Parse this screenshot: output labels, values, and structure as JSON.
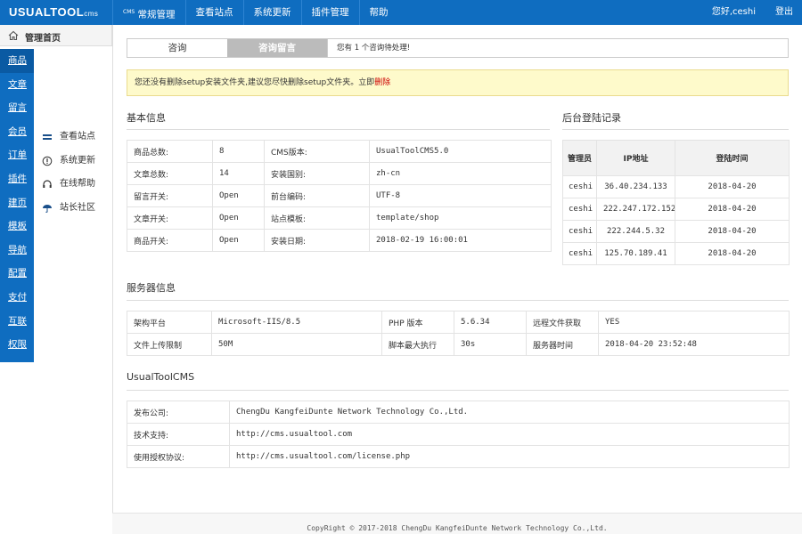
{
  "app": {
    "logo_main": "USUALTOOL",
    "logo_sub": "cms"
  },
  "topnav": [
    {
      "prefix": "CMS",
      "label": "常规管理"
    },
    {
      "prefix": "",
      "label": "查看站点"
    },
    {
      "prefix": "",
      "label": "系统更新"
    },
    {
      "prefix": "",
      "label": "插件管理"
    },
    {
      "prefix": "",
      "label": "帮助"
    }
  ],
  "user": {
    "greeting": "您好,ceshi",
    "logout": "登出"
  },
  "home": {
    "label": "管理首页",
    "icon": "home-icon"
  },
  "sidebar": [
    "商品",
    "文章",
    "留言",
    "会员",
    "订单",
    "插件",
    "建页",
    "模板",
    "导航",
    "配置",
    "支付",
    "互联",
    "权限"
  ],
  "submenu": [
    {
      "label": "查看站点",
      "icon": "monitor-icon"
    },
    {
      "label": "系统更新",
      "icon": "info-circle-icon"
    },
    {
      "label": "在线帮助",
      "icon": "headphones-icon"
    },
    {
      "label": "站长社区",
      "icon": "umbrella-icon"
    }
  ],
  "tabs": {
    "tab1": "咨询",
    "tab2": "咨询留言",
    "message": "您有 1 个咨询待处理!"
  },
  "warning": {
    "text": "您还没有删除setup安装文件夹,建议您尽快删除setup文件夹。立即",
    "link": "删除"
  },
  "basic": {
    "title": "基本信息",
    "rows": [
      [
        "商品总数:",
        "8",
        "CMS版本:",
        "UsualToolCMS5.0"
      ],
      [
        "文章总数:",
        "14",
        "安装国别:",
        "zh-cn"
      ],
      [
        "留言开关:",
        "Open",
        "前台编码:",
        "UTF-8"
      ],
      [
        "文章开关:",
        "Open",
        "站点模板:",
        "template/shop"
      ],
      [
        "商品开关:",
        "Open",
        "安装日期:",
        "2018-02-19 16:00:01"
      ]
    ]
  },
  "login": {
    "title": "后台登陆记录",
    "headers": [
      "管理员",
      "IP地址",
      "登陆时间"
    ],
    "rows": [
      [
        "ceshi",
        "36.40.234.133",
        "2018-04-20"
      ],
      [
        "ceshi",
        "222.247.172.152",
        "2018-04-20"
      ],
      [
        "ceshi",
        "222.244.5.32",
        "2018-04-20"
      ],
      [
        "ceshi",
        "125.70.189.41",
        "2018-04-20"
      ]
    ]
  },
  "server": {
    "title": "服务器信息",
    "rows": [
      [
        "架构平台",
        "Microsoft-IIS/8.5",
        "PHP 版本",
        "5.6.34",
        "远程文件获取",
        "YES"
      ],
      [
        "文件上传限制",
        "50M",
        "脚本最大执行",
        "30s",
        "服务器时间",
        "2018-04-20 23:52:48"
      ]
    ]
  },
  "about": {
    "title": "UsualToolCMS",
    "rows": [
      [
        "发布公司:",
        "ChengDu KangfeiDunte Network Technology Co.,Ltd."
      ],
      [
        "技术支持:",
        "http://cms.usualtool.com"
      ],
      [
        "使用授权协议:",
        "http://cms.usualtool.com/license.php"
      ]
    ]
  },
  "footer": "CopyRight © 2017-2018 ChengDu KangfeiDunte Network Technology Co.,Ltd.",
  "colors": {
    "primary": "#0f6dc0",
    "warning_bg": "#fefacb",
    "warning_link": "#cc0000"
  }
}
